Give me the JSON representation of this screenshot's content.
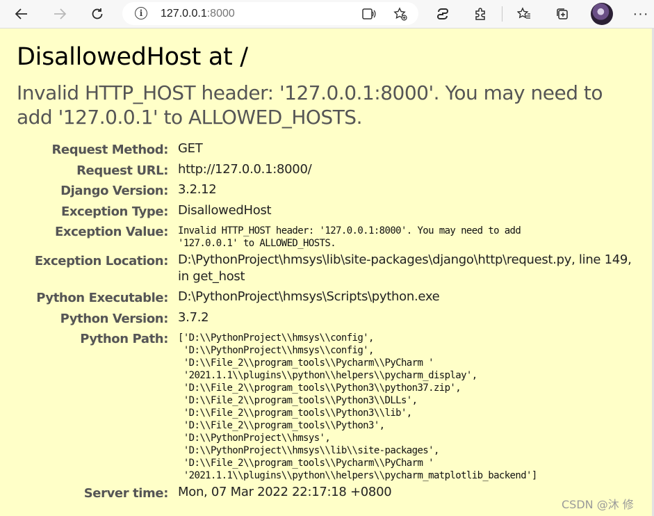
{
  "browser": {
    "url_host": "127.0.0.1",
    "url_port": ":8000",
    "icons": [
      "back-arrow-icon",
      "forward-arrow-icon",
      "refresh-icon",
      "info-icon",
      "read-aloud-icon",
      "add-favorite-icon",
      "copilot-icon",
      "extensions-icon",
      "favorites-icon",
      "collections-icon",
      "profile-avatar",
      "more-icon"
    ]
  },
  "error": {
    "title": "DisallowedHost at /",
    "message": "Invalid HTTP_HOST header: '127.0.0.1:8000'. You may need to add '127.0.0.1' to ALLOWED_HOSTS."
  },
  "meta": {
    "request_method": {
      "label": "Request Method:",
      "value": "GET"
    },
    "request_url": {
      "label": "Request URL:",
      "value": "http://127.0.0.1:8000/"
    },
    "django_version": {
      "label": "Django Version:",
      "value": "3.2.12"
    },
    "exception_type": {
      "label": "Exception Type:",
      "value": "DisallowedHost"
    },
    "exception_value": {
      "label": "Exception Value:",
      "value": "Invalid HTTP_HOST header: '127.0.0.1:8000'. You may need to add\n'127.0.0.1' to ALLOWED_HOSTS."
    },
    "exception_location": {
      "label": "Exception Location:",
      "value": "D:\\PythonProject\\hmsys\\lib\\site-packages\\django\\http\\request.py, line 149, in get_host"
    },
    "python_executable": {
      "label": "Python Executable:",
      "value": "D:\\PythonProject\\hmsys\\Scripts\\python.exe"
    },
    "python_version": {
      "label": "Python Version:",
      "value": "3.7.2"
    },
    "python_path": {
      "label": "Python Path:",
      "value": "['D:\\\\PythonProject\\\\hmsys\\\\config',\n 'D:\\\\PythonProject\\\\hmsys\\\\config',\n 'D:\\\\File_2\\\\program_tools\\\\Pycharm\\\\PyCharm '\n '2021.1.1\\\\plugins\\\\python\\\\helpers\\\\pycharm_display',\n 'D:\\\\File_2\\\\program_tools\\\\Python3\\\\python37.zip',\n 'D:\\\\File_2\\\\program_tools\\\\Python3\\\\DLLs',\n 'D:\\\\File_2\\\\program_tools\\\\Python3\\\\lib',\n 'D:\\\\File_2\\\\program_tools\\\\Python3',\n 'D:\\\\PythonProject\\\\hmsys',\n 'D:\\\\PythonProject\\\\hmsys\\\\lib\\\\site-packages',\n 'D:\\\\File_2\\\\program_tools\\\\Pycharm\\\\PyCharm '\n '2021.1.1\\\\plugins\\\\python\\\\helpers\\\\pycharm_matplotlib_backend']"
    },
    "server_time": {
      "label": "Server time:",
      "value": "Mon, 07 Mar 2022 22:17:18 +0800"
    }
  },
  "watermark": "CSDN @沐 修",
  "colors": {
    "page_bg": "#ffffc8",
    "toolbar_bg": "#f7f7f7",
    "label": "#555555"
  }
}
